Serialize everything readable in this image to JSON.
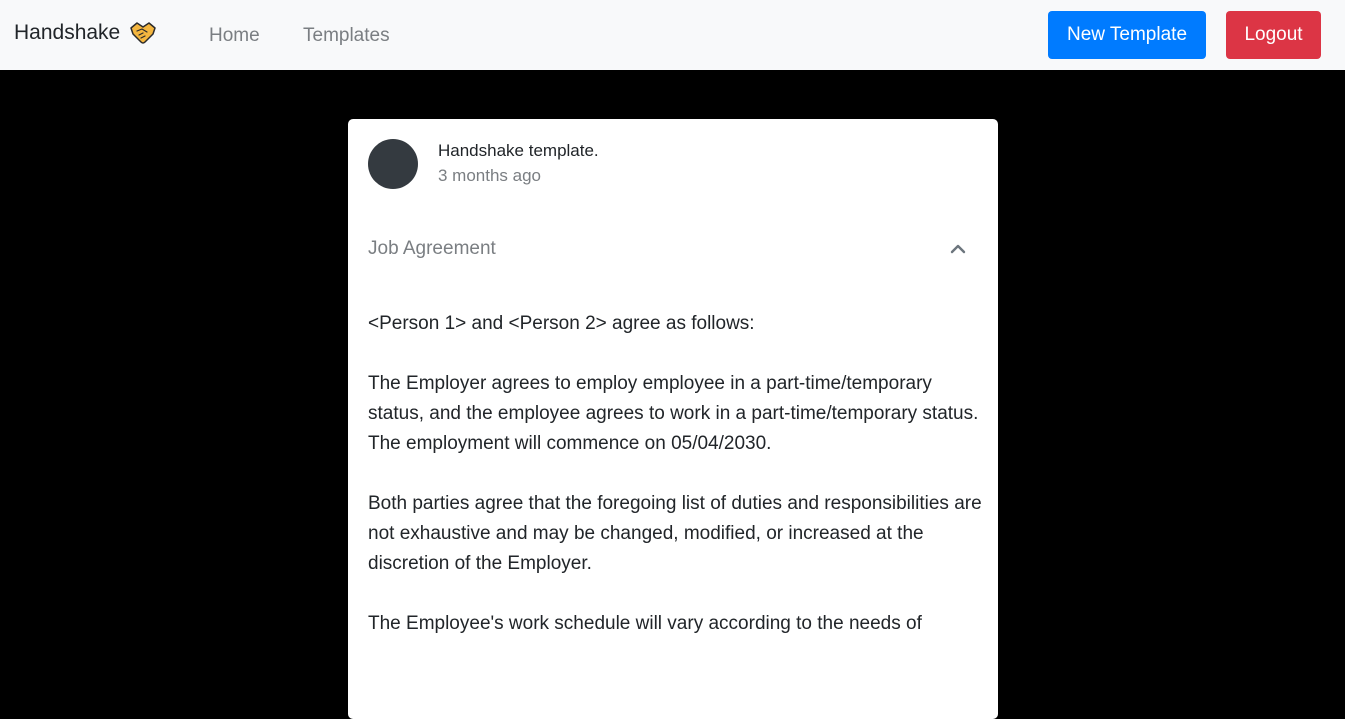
{
  "navbar": {
    "brand": "Handshake",
    "brand_icon": "handshake-icon",
    "links": [
      "Home",
      "Templates"
    ],
    "new_template_label": "New Template",
    "logout_label": "Logout",
    "colors": {
      "primary": "#007bff",
      "danger": "#dc3545"
    }
  },
  "card": {
    "author_name": "Handshake template.",
    "timestamp": "3 months ago",
    "section_title": "Job Agreement",
    "section_toggle_icon": "chevron-up-icon",
    "paragraphs": [
      "<Person 1> and <Person 2> agree as follows:",
      "The Employer agrees to employ employee in a part-time/temporary status, and the employee agrees to work in a part-time/temporary status. The employment will commence on 05/04/2030.",
      "Both parties agree that the foregoing list of duties and responsibilities are not exhaustive and may be changed, modified, or increased at the discretion of the Employer.",
      "The Employee's work schedule will vary according to the needs of"
    ]
  }
}
